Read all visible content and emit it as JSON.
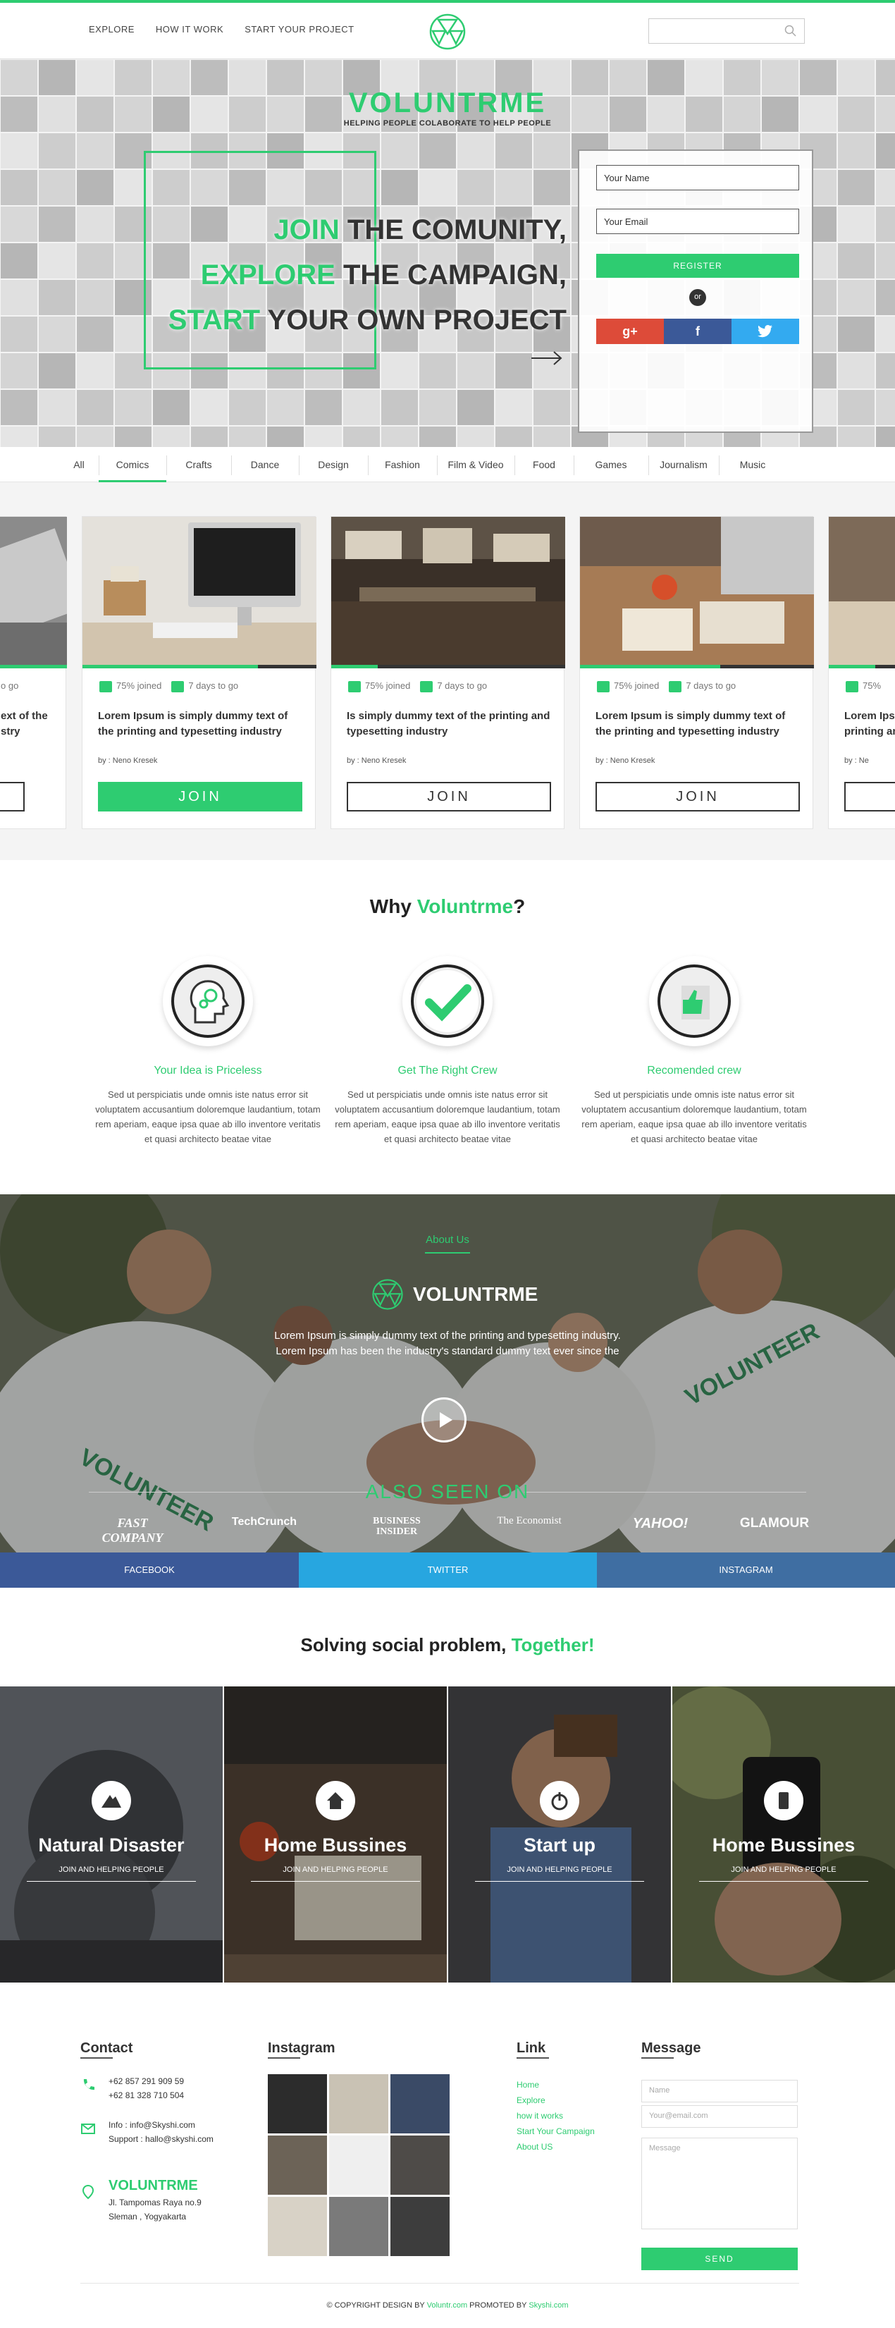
{
  "nav": {
    "links": [
      "EXPLORE",
      "HOW IT WORK",
      "START YOUR PROJECT"
    ],
    "search_placeholder": ""
  },
  "hero": {
    "brand": "VOLUNTRME",
    "tagline": "HELPING PEOPLE COLABORATE TO HELP PEOPLE",
    "lines": [
      {
        "accent": "JOIN",
        "rest": " THE COMUNITY,"
      },
      {
        "accent": "EXPLORE",
        "rest": " THE CAMPAIGN,"
      },
      {
        "accent": "START",
        "rest": " YOUR OWN PROJECT"
      }
    ],
    "form": {
      "name_value": "Your Name",
      "email_value": "Your Email",
      "register": "REGISTER",
      "or": "or",
      "google": "g+",
      "facebook": "f",
      "twitter": "t"
    }
  },
  "categories": [
    "All",
    "Comics",
    "Crafts",
    "Dance",
    "Design",
    "Fashion",
    "Film & Video",
    "Food",
    "Games",
    "Journalism",
    "Music"
  ],
  "active_category": "Comics",
  "cards": [
    {
      "joined": "75% joined",
      "days": "7 days to go",
      "title": "Lorem Ipsum is simply dummy text of the printing and typesetting industry",
      "by": "by : Neno Kresek",
      "button": "JOIN",
      "progress": 0.75
    },
    {
      "joined": "75% joined",
      "days": "7 days to go",
      "title": "Is simply dummy text of the printing and typesetting industry",
      "by": "by : Neno Kresek",
      "button": "JOIN",
      "progress": 0.2
    },
    {
      "joined": "75% joined",
      "days": "7 days to go",
      "title": "Lorem Ipsum is simply dummy text of the printing and typesetting industry",
      "by": "by : Neno Kresek",
      "button": "JOIN",
      "progress": 0.6
    }
  ],
  "partial_cards": {
    "left": {
      "days": "o go",
      "title_l1": "ext of the",
      "title_l2": "stry"
    },
    "right": {
      "joined": "75%",
      "title_l1": "Lorem Ips",
      "title_l2": "printing an",
      "by": "by : Ne"
    }
  },
  "why": {
    "title_pre": "Why ",
    "title_accent": "Voluntrme",
    "title_post": "?",
    "features": [
      {
        "title": "Your Idea is Priceless",
        "desc": "Sed ut perspiciatis unde omnis iste natus error sit voluptatem accusantium doloremque laudantium, totam rem aperiam, eaque ipsa quae ab illo inventore veritatis et quasi architecto beatae vitae",
        "icon": "head-gears-icon"
      },
      {
        "title": "Get The Right Crew",
        "desc": "Sed ut perspiciatis unde omnis iste natus error sit voluptatem accusantium doloremque laudantium, totam rem aperiam, eaque ipsa quae ab illo inventore veritatis et quasi architecto beatae vitae",
        "icon": "check-icon"
      },
      {
        "title": "Recomended crew",
        "desc": "Sed ut perspiciatis unde omnis iste natus error sit voluptatem accusantium doloremque laudantium, totam rem aperiam, eaque ipsa quae ab illo inventore veritatis et quasi architecto beatae vitae",
        "icon": "thumbs-up-icon"
      }
    ]
  },
  "about": {
    "label": "About Us",
    "brand": "VOLUNTRME",
    "text_l1": "Lorem Ipsum is simply dummy text of the printing and typesetting industry.",
    "text_l2": "Lorem Ipsum has been the industry's standard dummy text ever since the",
    "also_seen": "ALSO SEEN ON",
    "press": [
      "FAST COMPANY",
      "TechCrunch",
      "BUSINESS INSIDER",
      "The Economist",
      "YAHOO!",
      "GLAMOUR"
    ]
  },
  "social_bar": [
    {
      "label": "FACEBOOK",
      "color": "#3b5998"
    },
    {
      "label": "TWITTER",
      "color": "#27a6e0"
    },
    {
      "label": "INSTAGRAM",
      "color": "#3f6ea2"
    }
  ],
  "solve": {
    "title_pre": "Solving social problem, ",
    "title_accent": "Together!",
    "tiles": [
      {
        "name": "Natural Disaster",
        "sub": "JOIN AND HELPING PEOPLE",
        "icon": "volcano-icon"
      },
      {
        "name": "Home Bussines",
        "sub": "JOIN AND HELPING PEOPLE",
        "icon": "home-icon"
      },
      {
        "name": "Start up",
        "sub": "JOIN AND HELPING PEOPLE",
        "icon": "power-icon"
      },
      {
        "name": "Home Bussines",
        "sub": "JOIN AND HELPING PEOPLE",
        "icon": "phone-icon"
      }
    ]
  },
  "footer": {
    "contact_title": "Contact",
    "phone1": "+62 857 291 909 59",
    "phone2": "+62 81 328 710 504",
    "email1": "Info : info@Skyshi.com",
    "email2": "Support : hallo@skyshi.com",
    "brand": "VOLUNTRME",
    "addr1": "Jl. Tampomas Raya no.9",
    "addr2": "Sleman , Yogyakarta",
    "instagram_title": "Instagram",
    "link_title": "Link",
    "links": [
      "Home",
      "Explore",
      "how it works",
      "Start Your Campaign",
      "About US"
    ],
    "message_title": "Message",
    "name_ph": "Name",
    "email_ph": "Your@email.com",
    "message_ph": "Message",
    "send": "SEND",
    "copy_pre": "© COPYRIGHT DESIGN BY ",
    "copy_a1": "Voluntr.com",
    "copy_mid": " PROMOTED BY ",
    "copy_a2": "Skyshi.com"
  },
  "colors": {
    "accent": "#2ecc71",
    "dark": "#333333"
  }
}
